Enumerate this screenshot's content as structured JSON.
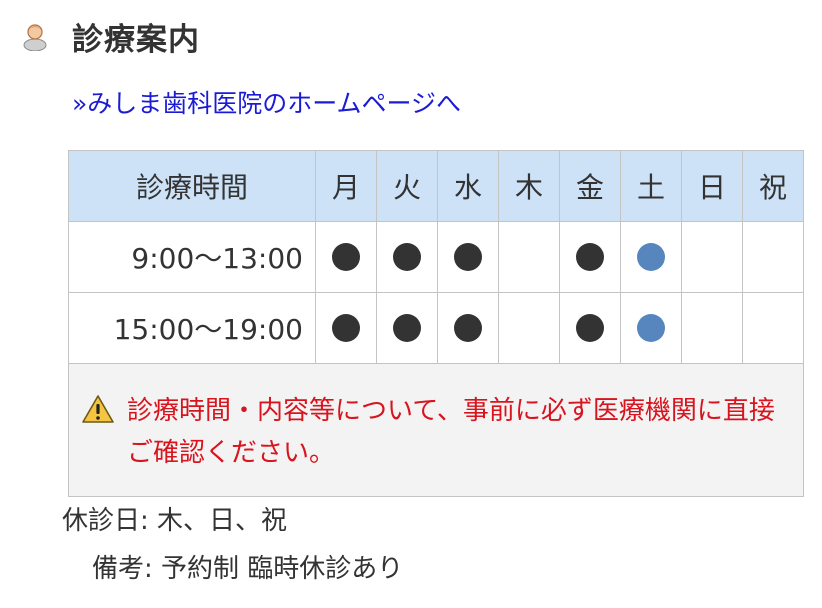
{
  "header": {
    "title": "診療案内",
    "icon": "person-icon"
  },
  "home_link": {
    "text": "»みしま歯科医院のホームページへ"
  },
  "schedule": {
    "time_header": "診療時間",
    "days": [
      "月",
      "火",
      "水",
      "木",
      "金",
      "土",
      "日",
      "祝"
    ],
    "rows": [
      {
        "time": "9:00〜13:00",
        "open": [
          true,
          true,
          true,
          false,
          true,
          true,
          false,
          false
        ]
      },
      {
        "time": "15:00〜19:00",
        "open": [
          true,
          true,
          true,
          false,
          true,
          true,
          false,
          false
        ]
      }
    ],
    "notice": "診療時間・内容等について、事前に必ず医療機関に直接ご確認ください。"
  },
  "info": {
    "closed_days": "休診日: 木、日、祝",
    "remarks": "備考: 予約制 臨時休診あり"
  },
  "colors": {
    "saturday": "#4a7eb7",
    "sunday_holiday": "#d8141e",
    "link": "#1b1bd6",
    "header_bg": "#cde2f7"
  }
}
